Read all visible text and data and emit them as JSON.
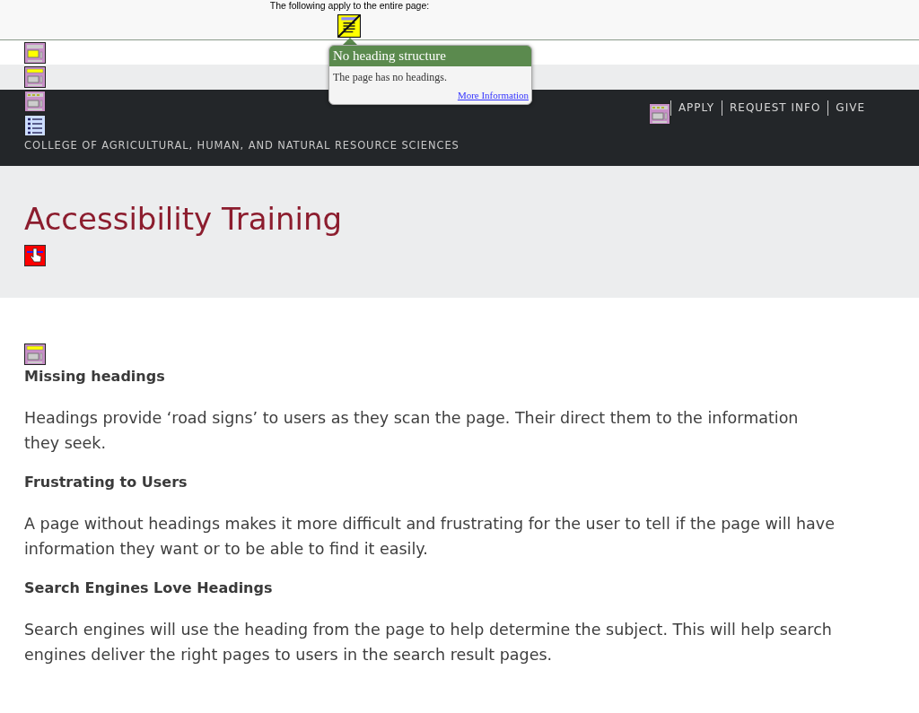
{
  "notice": {
    "text": "The following apply to the entire page:"
  },
  "tooltip": {
    "title": "No heading structure",
    "body": "The page has no headings.",
    "link": "More Information"
  },
  "header": {
    "nav": [
      "APPLY",
      "REQUEST INFO",
      "GIVE"
    ],
    "college": "COLLEGE OF AGRICULTURAL, HUMAN, AND NATURAL RESOURCE SCIENCES"
  },
  "hero": {
    "title": "Accessibility Training"
  },
  "sections": [
    {
      "heading": "Missing headings",
      "text": "Headings provide ‘road signs’ to users as they scan the page. Their direct them to the information they seek."
    },
    {
      "heading": "Frustrating to Users",
      "text": "A page without headings makes it more difficult and frustrating for the user to tell if the page will have information they want or to be able to find it easily."
    },
    {
      "heading": "Search Engines Love Headings",
      "text": "Search engines will use the heading from the page to help determine the subject. This will help search engines deliver the right pages to users in the search result pages."
    }
  ]
}
